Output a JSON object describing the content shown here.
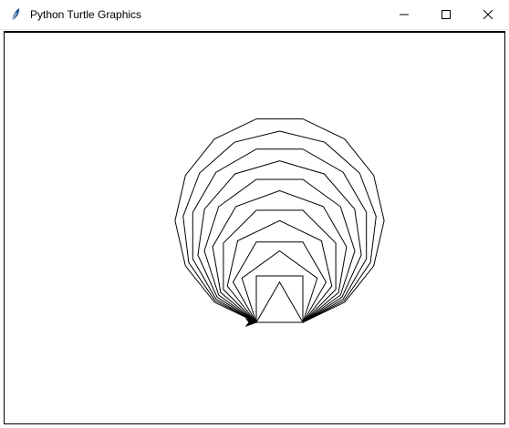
{
  "window": {
    "title": "Python Turtle Graphics",
    "title_icon": "feather-icon",
    "controls": [
      "minimize-icon",
      "maximize-icon",
      "close-icon"
    ]
  },
  "canvas": {
    "background": "#ffffff",
    "stroke": "#000000",
    "figure": "nested polygons (triangle, square, pentagon ... 14-gon) sharing a common base edge",
    "polygon_sides": [
      3,
      4,
      5,
      6,
      7,
      8,
      9,
      10,
      11,
      12,
      13,
      14
    ],
    "turtle_cursor": "arrow-icon"
  }
}
